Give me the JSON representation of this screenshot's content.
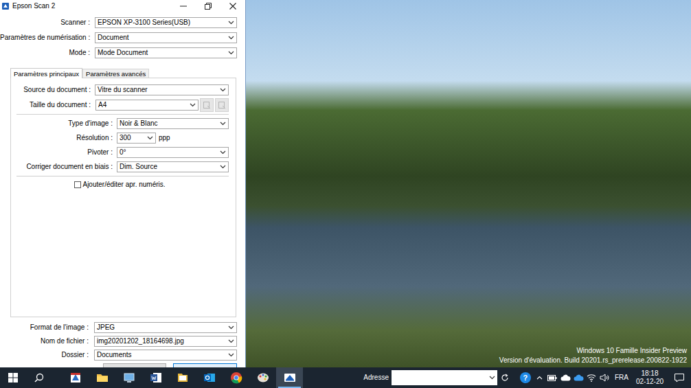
{
  "window": {
    "title": "Epson Scan 2"
  },
  "top_fields": [
    {
      "label": "Scanner :",
      "value": "EPSON XP-3100 Series(USB)"
    },
    {
      "label": "Paramètres de numérisation :",
      "value": "Document"
    },
    {
      "label": "Mode :",
      "value": "Mode Document"
    }
  ],
  "tabs": [
    {
      "label": "Paramètres principaux",
      "selected": true
    },
    {
      "label": "Paramètres avancés",
      "selected": false
    }
  ],
  "main_groups": [
    [
      {
        "kind": "select",
        "label": "Source du document :",
        "value": "Vitre du scanner"
      },
      {
        "kind": "select-with-buttons",
        "label": "Taille du document :",
        "value": "A4",
        "buttons_disabled": true
      }
    ],
    [
      {
        "kind": "select",
        "label": "Type d'image :",
        "value": "Noir & Blanc"
      },
      {
        "kind": "combo",
        "label": "Résolution :",
        "value": "300",
        "unit": "ppp"
      },
      {
        "kind": "select",
        "label": "Pivoter :",
        "value": "0°"
      },
      {
        "kind": "select",
        "label": "Corriger document en biais :",
        "value": "Dim. Source"
      }
    ]
  ],
  "option": {
    "label": "Ajouter/éditer apr. numéris.",
    "checked": false
  },
  "bottom_fields": [
    {
      "label": "Format de l'image :",
      "value": "JPEG"
    },
    {
      "label": "Nom de fichier :",
      "value": "img20201202_18164698.jpg"
    },
    {
      "label": "Dossier :",
      "value": "Documents"
    }
  ],
  "desktop": {
    "watermark": [
      "Windows 10 Famille Insider Preview",
      "Version d'évaluation. Build 20201.rs_prerelease.200822-1922"
    ]
  },
  "taskbar": {
    "apps": [
      {
        "active": false
      },
      {
        "active": false
      },
      {
        "active": false
      },
      {
        "active": false
      },
      {
        "active": false
      },
      {
        "active": false
      },
      {
        "active": false
      },
      {
        "active": false
      },
      {
        "active": true
      }
    ],
    "address": {
      "label": "Adresse",
      "value": ""
    },
    "help": "?",
    "language": "FRA",
    "time": "18:18",
    "date": "02-12-20"
  }
}
